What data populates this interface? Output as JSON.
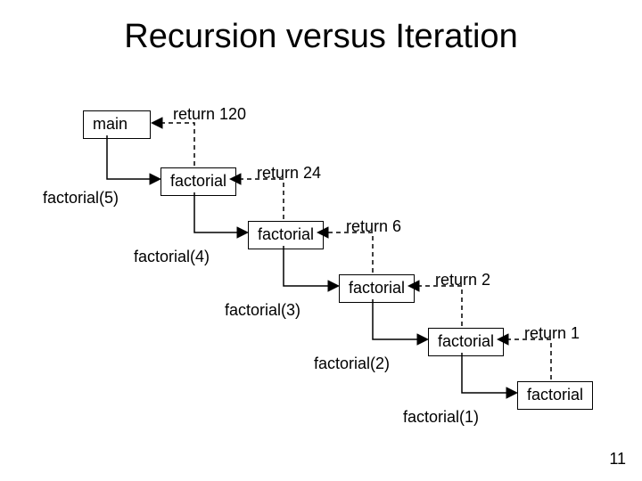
{
  "title": "Recursion versus Iteration",
  "page_number": "11",
  "boxes": {
    "main": "main",
    "fact_a": "factorial",
    "fact_b": "factorial",
    "fact_c": "factorial",
    "fact_d": "factorial",
    "fact_e": "factorial"
  },
  "calls": {
    "c5": "factorial(5)",
    "c4": "factorial(4)",
    "c3": "factorial(3)",
    "c2": "factorial(2)",
    "c1": "factorial(1)"
  },
  "returns": {
    "r120": "return 120",
    "r24": "return 24",
    "r6": "return 6",
    "r2": "return 2",
    "r1": "return 1"
  }
}
